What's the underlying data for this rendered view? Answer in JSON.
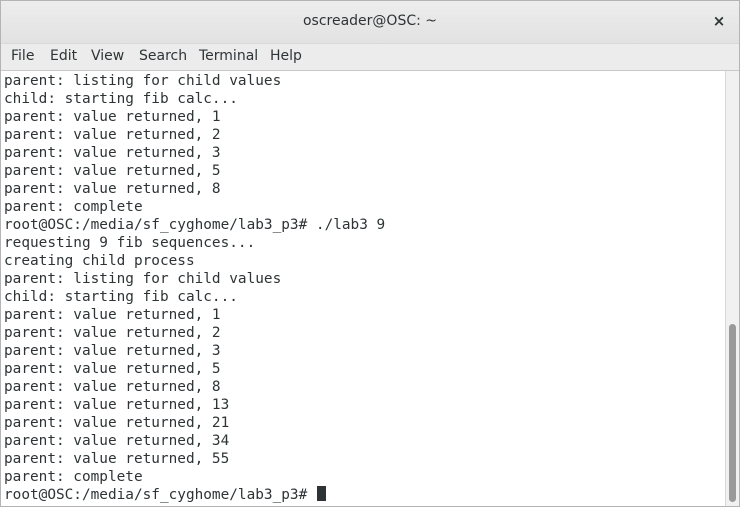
{
  "window": {
    "title": "oscreader@OSC: ~",
    "close_label": "×"
  },
  "menu": {
    "items": [
      "File",
      "Edit",
      "View",
      "Search",
      "Terminal",
      "Help"
    ]
  },
  "terminal": {
    "lines": [
      "parent: listing for child values",
      "child: starting fib calc...",
      "parent: value returned, 1",
      "parent: value returned, 2",
      "parent: value returned, 3",
      "parent: value returned, 5",
      "parent: value returned, 8",
      "parent: complete",
      "root@OSC:/media/sf_cyghome/lab3_p3# ./lab3 9",
      "requesting 9 fib sequences...",
      "creating child process",
      "parent: listing for child values",
      "child: starting fib calc...",
      "parent: value returned, 1",
      "parent: value returned, 2",
      "parent: value returned, 3",
      "parent: value returned, 5",
      "parent: value returned, 8",
      "parent: value returned, 13",
      "parent: value returned, 21",
      "parent: value returned, 34",
      "parent: value returned, 55",
      "parent: complete"
    ],
    "prompt": "root@OSC:/media/sf_cyghome/lab3_p3# "
  },
  "icons": {
    "close": "close-icon",
    "cursor": "block-cursor"
  },
  "colors": {
    "text": "#2e3436",
    "background": "#ffffff"
  }
}
